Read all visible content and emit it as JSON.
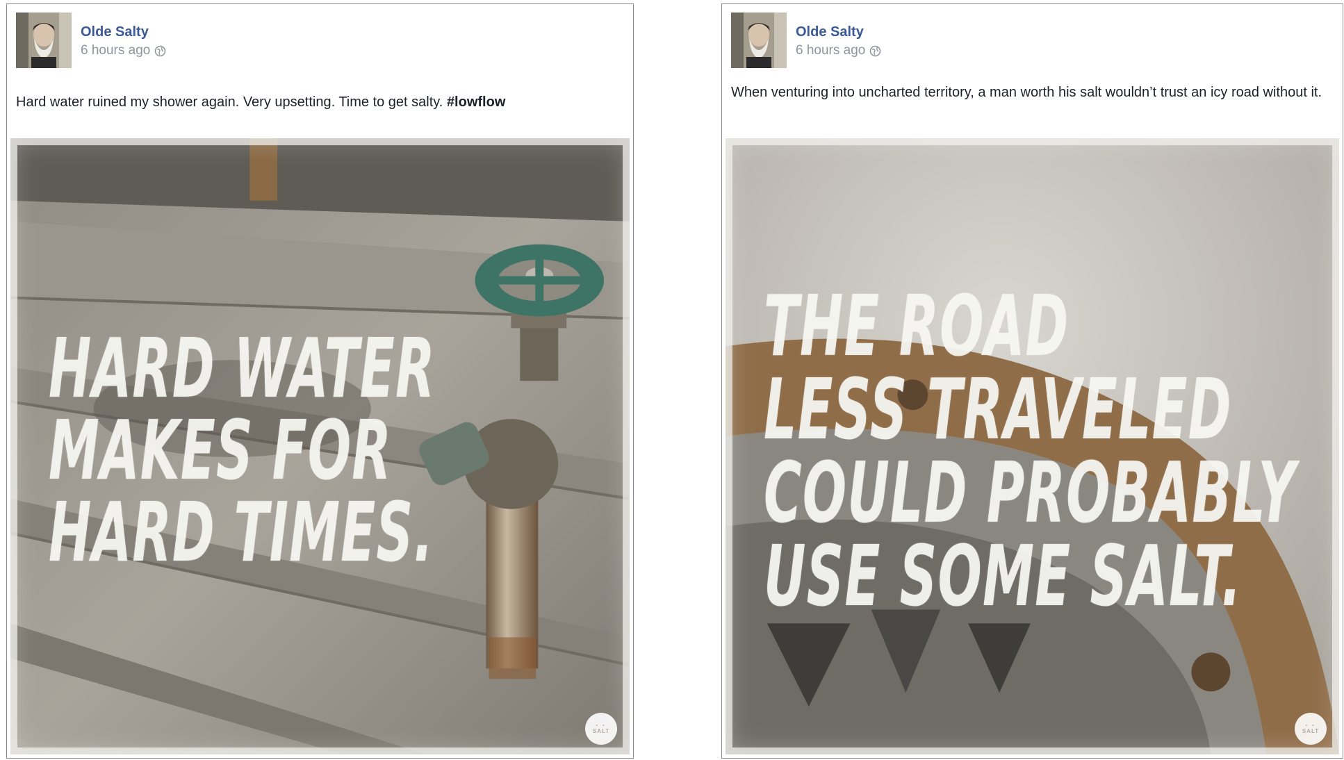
{
  "posts": [
    {
      "author": "Olde Salty",
      "time": "6 hours ago",
      "caption_text": "Hard water ruined my shower again. Very upsetting. Time to get salty.",
      "hashtag": "#lowflow",
      "headline_lines": [
        "HARD WATER",
        "MAKES FOR",
        "HARD TIMES."
      ],
      "badge_text": "SALT"
    },
    {
      "author": "Olde Salty",
      "time": "6 hours ago",
      "caption_text": "When venturing into uncharted territory, a man worth his salt wouldn’t trust an icy road without it.",
      "hashtag": "",
      "headline_lines": [
        "THE ROAD",
        "LESS TRAVELED",
        "COULD PROBABLY",
        "USE SOME SALT."
      ],
      "badge_text": "SALT"
    }
  ],
  "icons": {
    "globe": "globe-icon",
    "avatar": "avatar"
  },
  "colors": {
    "author_link": "#3b5998",
    "meta_text": "#90949c",
    "body_text": "#1d2129"
  }
}
